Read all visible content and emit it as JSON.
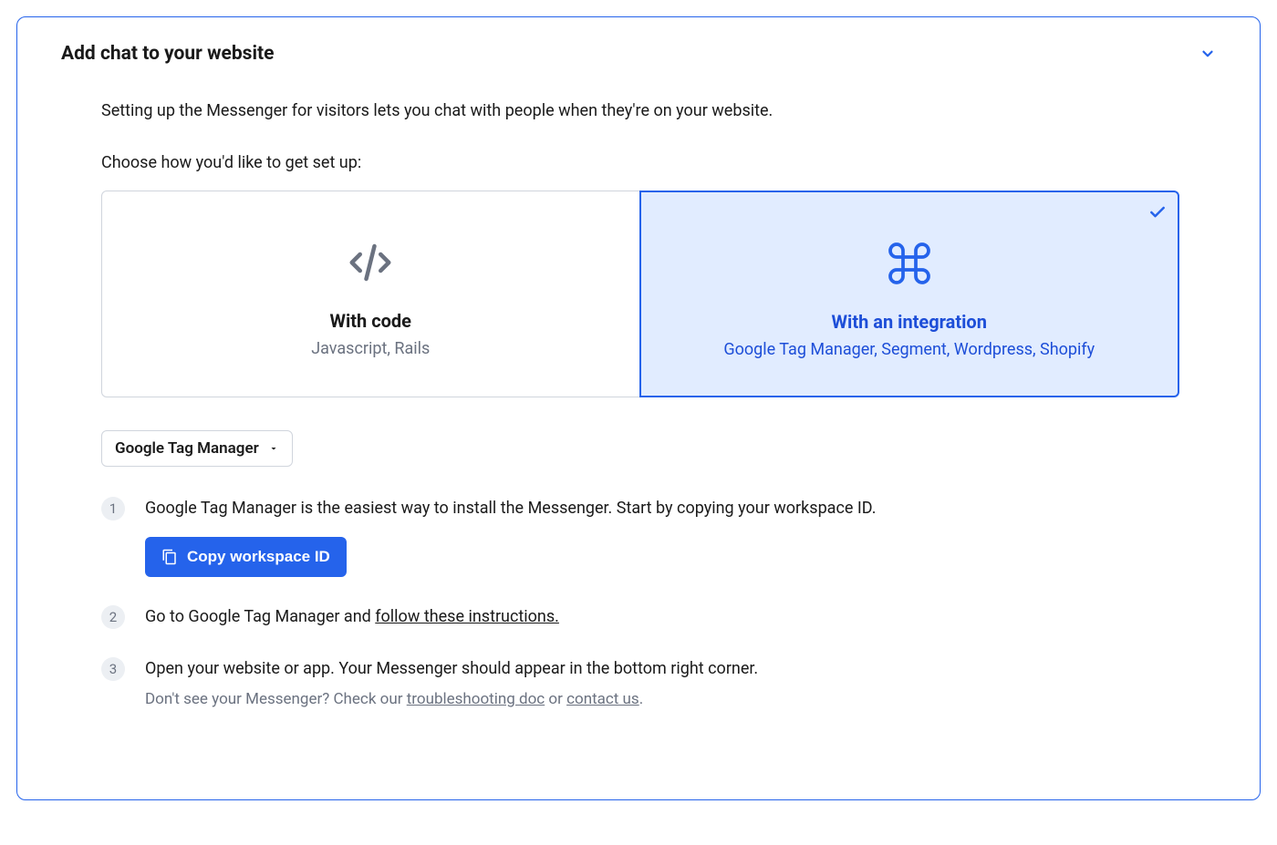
{
  "panel": {
    "title": "Add chat to your website"
  },
  "intro": "Setting up the Messenger for visitors lets you chat with people when they're on your website.",
  "choose_label": "Choose how you'd like to get set up:",
  "options": {
    "with_code": {
      "title": "With code",
      "subtitle": "Javascript, Rails"
    },
    "with_integration": {
      "title": "With an integration",
      "subtitle": "Google Tag Manager, Segment, Wordpress, Shopify"
    }
  },
  "dropdown": {
    "selected": "Google Tag Manager"
  },
  "steps": {
    "s1": {
      "num": "1",
      "text": "Google Tag Manager is the easiest way to install the Messenger. Start by copying your workspace ID.",
      "button": "Copy workspace ID"
    },
    "s2": {
      "num": "2",
      "text_prefix": "Go to Google Tag Manager and ",
      "link": "follow these instructions."
    },
    "s3": {
      "num": "3",
      "text": "Open your website or app. Your Messenger should appear in the bottom right corner.",
      "hint_prefix": "Don't see your Messenger? Check our ",
      "hint_link1": "troubleshooting doc",
      "hint_mid": " or ",
      "hint_link2": "contact us",
      "hint_suffix": "."
    }
  }
}
